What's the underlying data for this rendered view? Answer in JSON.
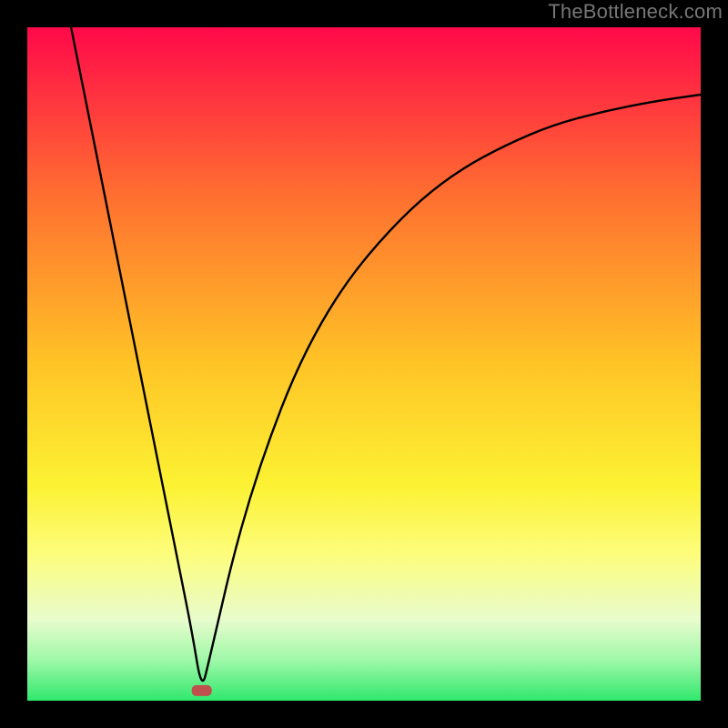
{
  "attribution": "TheBottleneck.com",
  "chart_data": {
    "type": "line",
    "title": "",
    "xlabel": "",
    "ylabel": "",
    "xlim": [
      0,
      100
    ],
    "ylim": [
      0,
      100
    ],
    "gradient_stops": [
      {
        "offset": 0,
        "color": "#ff094a"
      },
      {
        "offset": 25,
        "color": "#ff6f30"
      },
      {
        "offset": 50,
        "color": "#ffc426"
      },
      {
        "offset": 68,
        "color": "#fcf233"
      },
      {
        "offset": 78,
        "color": "#fdfd7a"
      },
      {
        "offset": 88,
        "color": "#e8fccd"
      },
      {
        "offset": 94,
        "color": "#9ef8a8"
      },
      {
        "offset": 100,
        "color": "#30e86c"
      }
    ],
    "marker": {
      "x": 25.9,
      "y": 98.5,
      "color": "#c0504d"
    },
    "series": [
      {
        "name": "curve",
        "points": [
          {
            "x": 6.5,
            "y": 0.0
          },
          {
            "x": 7.5,
            "y": 5.0
          },
          {
            "x": 9.0,
            "y": 12.5
          },
          {
            "x": 11.0,
            "y": 22.5
          },
          {
            "x": 13.0,
            "y": 32.5
          },
          {
            "x": 15.5,
            "y": 45.0
          },
          {
            "x": 18.0,
            "y": 57.5
          },
          {
            "x": 20.5,
            "y": 70.0
          },
          {
            "x": 22.5,
            "y": 80.0
          },
          {
            "x": 24.5,
            "y": 90.0
          },
          {
            "x": 25.9,
            "y": 98.5
          },
          {
            "x": 27.0,
            "y": 94.0
          },
          {
            "x": 28.5,
            "y": 87.5
          },
          {
            "x": 30.5,
            "y": 79.0
          },
          {
            "x": 33.0,
            "y": 70.0
          },
          {
            "x": 36.0,
            "y": 61.0
          },
          {
            "x": 39.5,
            "y": 52.0
          },
          {
            "x": 43.5,
            "y": 44.0
          },
          {
            "x": 48.0,
            "y": 37.0
          },
          {
            "x": 53.0,
            "y": 31.0
          },
          {
            "x": 58.5,
            "y": 25.5
          },
          {
            "x": 64.5,
            "y": 21.0
          },
          {
            "x": 71.0,
            "y": 17.5
          },
          {
            "x": 78.0,
            "y": 14.5
          },
          {
            "x": 85.5,
            "y": 12.5
          },
          {
            "x": 93.0,
            "y": 11.0
          },
          {
            "x": 100.0,
            "y": 10.0
          }
        ]
      }
    ]
  }
}
